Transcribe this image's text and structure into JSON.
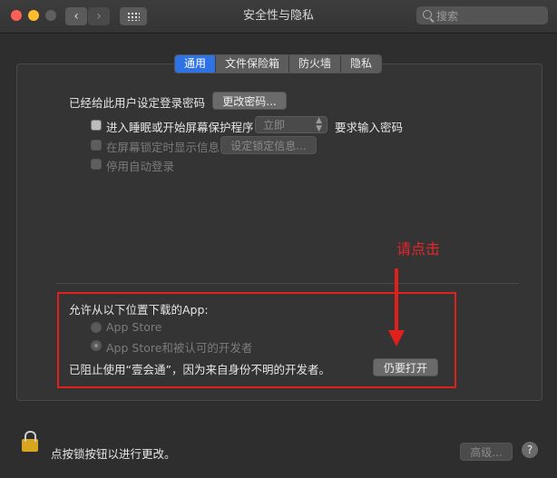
{
  "window": {
    "title": "安全性与隐私",
    "nav_back": "‹",
    "nav_forward": "›",
    "search_placeholder": "搜索"
  },
  "tabs": [
    {
      "label": "通用",
      "active": true
    },
    {
      "label": "文件保险箱",
      "active": false
    },
    {
      "label": "防火墙",
      "active": false
    },
    {
      "label": "隐私",
      "active": false
    }
  ],
  "general": {
    "password_set_text": "已经给此用户设定登录密码",
    "change_password_button": "更改密码...",
    "require_password_label": "进入睡眠或开始屏幕保护程序",
    "require_password_select": "立即",
    "require_password_suffix": "要求输入密码",
    "lock_message_label": "在屏幕锁定时显示信息",
    "lock_message_button": "设定锁定信息...",
    "auto_login_label": "停用自动登录"
  },
  "gatekeeper": {
    "heading": "允许从以下位置下载的App:",
    "option_app_store": "App Store",
    "option_app_store_identified": "App Store和被认可的开发者",
    "blocked_message": "已阻止使用“壹会通”，因为来自身份不明的开发者。",
    "open_anyway_button": "仍要打开"
  },
  "annotation": {
    "text": "请点击",
    "color": "#e0201a"
  },
  "footer": {
    "lock_text": "点按锁按钮以进行更改。",
    "advanced_button": "高级...",
    "help_button": "?"
  },
  "colors": {
    "accent": "#2f72e5",
    "background": "#2e2e2f"
  }
}
